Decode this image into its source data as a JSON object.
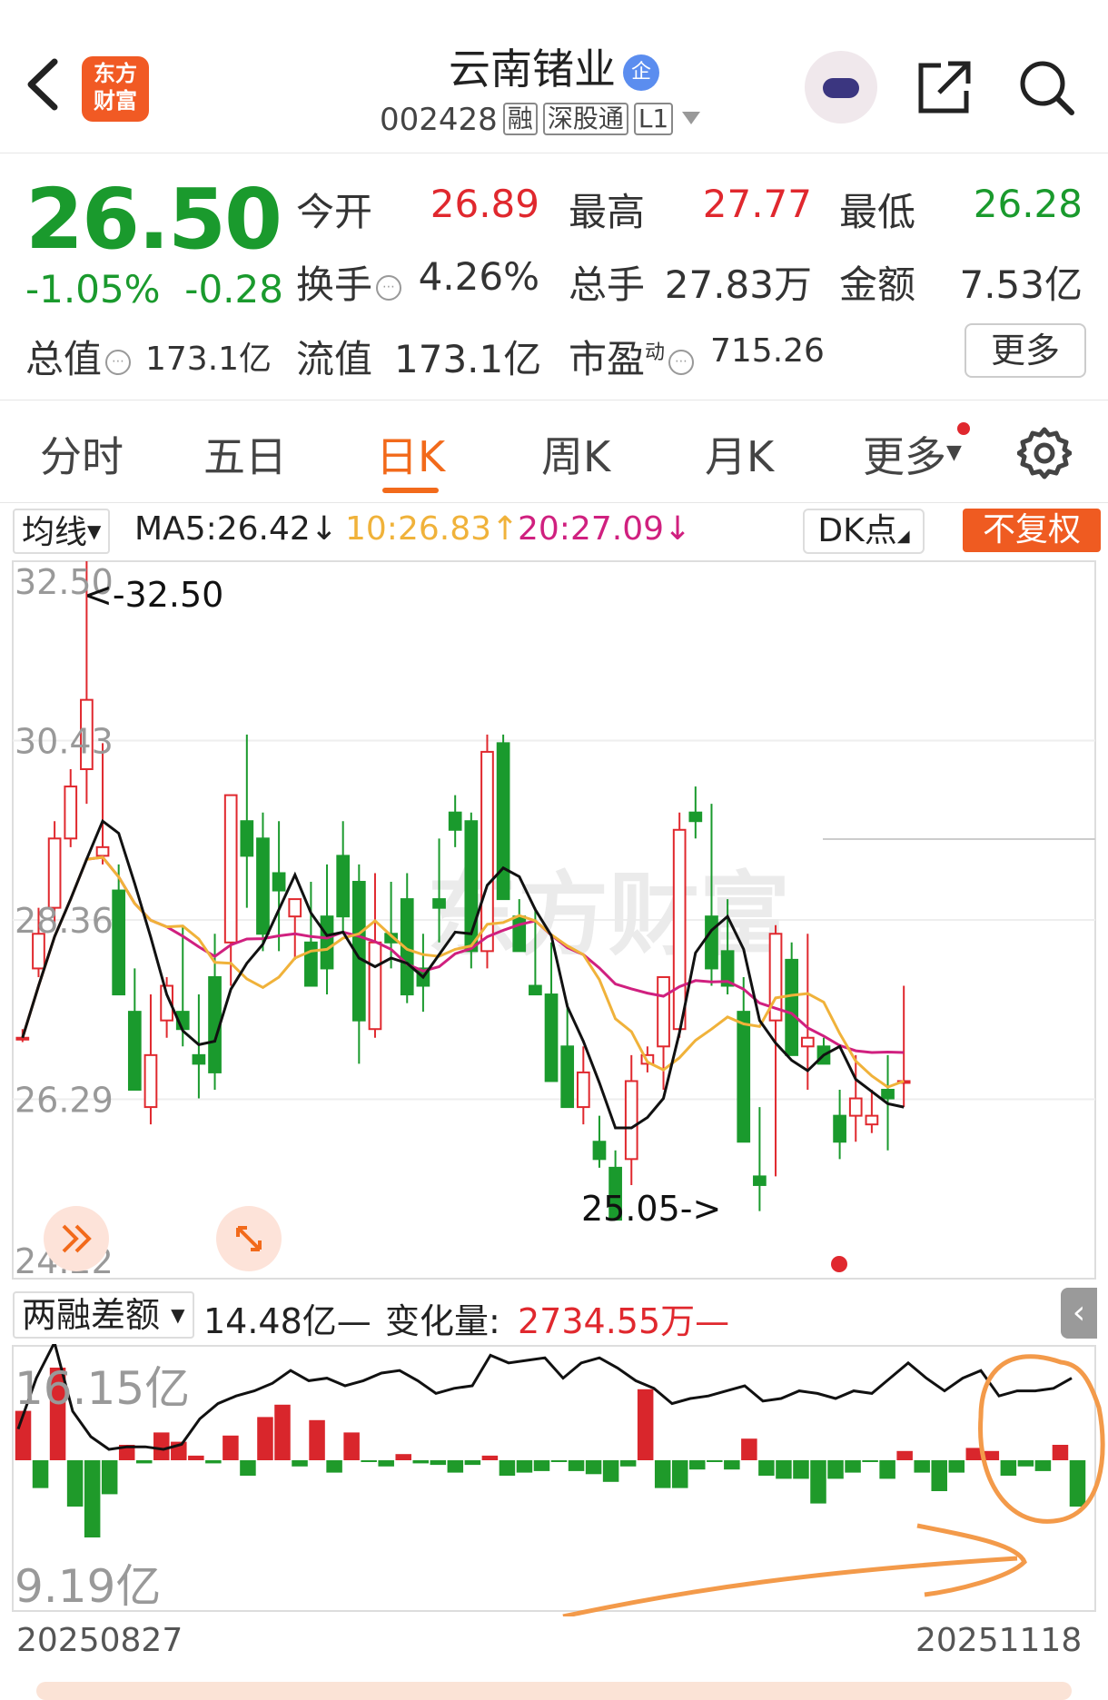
{
  "header": {
    "back_icon": "chevron-left-icon",
    "logo_text_line1": "东方",
    "logo_text_line2": "财富",
    "stock_name": "云南锗业",
    "qi_badge": "企",
    "stock_code": "002428",
    "tags": [
      "融",
      "深股通",
      "L1"
    ],
    "icons": [
      "assistant-robot-icon",
      "share-icon",
      "search-icon"
    ]
  },
  "quote": {
    "price": "26.50",
    "change_pct": "-1.05%",
    "change_amt": "-0.28",
    "open_label": "今开",
    "open": "26.89",
    "high_label": "最高",
    "high": "27.77",
    "low_label": "最低",
    "low": "26.28",
    "turnover_label": "换手",
    "turnover": "4.26%",
    "volume_label": "总手",
    "volume": "27.83万",
    "amount_label": "金额",
    "amount": "7.53亿",
    "mktcap_label": "总值",
    "mktcap": "173.1亿",
    "float_label": "流值",
    "float_cap": "173.1亿",
    "pe_label": "市盈",
    "pe_sup": "动",
    "pe": "715.26",
    "more_button": "更多",
    "colors": {
      "up": "#e0282e",
      "down": "#1a9a2d"
    }
  },
  "tabs": {
    "items": [
      "分时",
      "五日",
      "日K",
      "周K",
      "月K",
      "更多"
    ],
    "active": "日K"
  },
  "ma": {
    "selector": "均线",
    "ma5": "MA5:26.42↓",
    "ma10": "10:26.83↑",
    "ma20": "20:27.09↓",
    "dk_button": "DK点",
    "fq_button": "不复权",
    "colors": {
      "ma5": "#111111",
      "ma10": "#f0b23a",
      "ma20": "#d0207f"
    }
  },
  "chart_data": [
    {
      "type": "candlestick",
      "y_ticks": [
        "32.50",
        "30.43",
        "28.36",
        "26.29",
        "24.22"
      ],
      "ylim": [
        24.22,
        32.5
      ],
      "high_marker": "<-32.50",
      "low_marker": "25.05->",
      "watermark": "东方财富",
      "candles": [
        [
          27.0,
          27.1,
          26.95,
          27.0
        ],
        [
          27.8,
          28.5,
          27.7,
          28.2
        ],
        [
          28.5,
          29.5,
          28.3,
          29.3
        ],
        [
          29.3,
          30.1,
          29.2,
          29.9
        ],
        [
          30.1,
          32.5,
          29.7,
          30.9
        ],
        [
          29.1,
          30.4,
          29.0,
          29.2
        ],
        [
          28.7,
          29.0,
          27.8,
          27.5
        ],
        [
          27.3,
          27.8,
          26.8,
          26.4
        ],
        [
          26.2,
          27.5,
          26.0,
          26.8
        ],
        [
          27.2,
          27.7,
          27.0,
          27.6
        ],
        [
          27.3,
          28.3,
          26.9,
          27.1
        ],
        [
          26.8,
          27.5,
          26.3,
          26.7
        ],
        [
          27.7,
          28.2,
          26.4,
          26.6
        ],
        [
          28.1,
          29.3,
          27.6,
          29.8
        ],
        [
          29.5,
          30.5,
          28.5,
          29.1
        ],
        [
          29.3,
          29.6,
          28.0,
          28.2
        ],
        [
          28.9,
          29.5,
          28.0,
          28.7
        ],
        [
          28.4,
          28.6,
          27.9,
          28.6
        ],
        [
          28.1,
          28.8,
          27.6,
          27.6
        ],
        [
          28.4,
          29.0,
          27.5,
          27.8
        ],
        [
          29.1,
          29.5,
          28.2,
          28.4
        ],
        [
          28.8,
          29.0,
          26.7,
          27.2
        ],
        [
          27.1,
          28.9,
          27.0,
          28.1
        ],
        [
          28.2,
          28.8,
          27.8,
          28.1
        ],
        [
          28.6,
          28.9,
          27.4,
          27.5
        ],
        [
          27.8,
          28.2,
          27.3,
          27.6
        ],
        [
          28.6,
          29.3,
          28.1,
          28.5
        ],
        [
          29.6,
          29.8,
          29.2,
          29.4
        ],
        [
          29.5,
          29.6,
          27.8,
          28.0
        ],
        [
          28.0,
          30.5,
          27.8,
          30.3
        ],
        [
          30.4,
          30.5,
          28.6,
          28.6
        ],
        [
          28.4,
          28.6,
          28.0,
          28.0
        ],
        [
          27.6,
          28.5,
          27.5,
          27.5
        ],
        [
          27.5,
          28.1,
          26.7,
          26.5
        ],
        [
          26.9,
          27.4,
          26.2,
          26.2
        ],
        [
          26.2,
          26.9,
          26.0,
          26.6
        ],
        [
          25.8,
          26.1,
          25.5,
          25.6
        ],
        [
          25.5,
          25.7,
          25.05,
          24.9
        ],
        [
          25.6,
          26.8,
          25.3,
          26.5
        ],
        [
          26.7,
          26.9,
          26.6,
          26.8
        ],
        [
          26.9,
          27.7,
          26.4,
          27.7
        ],
        [
          27.1,
          29.6,
          27.0,
          29.4
        ],
        [
          29.6,
          29.9,
          29.3,
          29.5
        ],
        [
          28.4,
          29.7,
          27.6,
          27.8
        ],
        [
          28.0,
          28.6,
          27.5,
          27.6
        ],
        [
          27.3,
          27.7,
          26.0,
          25.8
        ],
        [
          25.4,
          26.2,
          25.0,
          25.3
        ],
        [
          27.2,
          28.3,
          25.4,
          28.2
        ],
        [
          27.9,
          28.1,
          26.9,
          26.8
        ],
        [
          26.9,
          28.2,
          26.4,
          27.0
        ],
        [
          26.9,
          27.0,
          26.7,
          26.7
        ],
        [
          26.1,
          26.4,
          25.6,
          25.8
        ],
        [
          26.1,
          26.8,
          25.8,
          26.3
        ],
        [
          26.0,
          26.4,
          25.9,
          26.1
        ],
        [
          26.4,
          26.8,
          25.7,
          26.3
        ],
        [
          26.5,
          27.6,
          26.2,
          26.5
        ]
      ]
    },
    {
      "type": "bar+line",
      "label": "两融差额",
      "latest": "14.48亿—",
      "change_label": "变化量:",
      "change": "2734.55万—",
      "y_ticks": [
        "16.15亿",
        "9.19亿"
      ],
      "x_start": "20250827",
      "x_end": "20251118",
      "change_bars": [
        32,
        -18,
        60,
        -30,
        -50,
        -22,
        10,
        -2,
        18,
        12,
        3,
        -2,
        16,
        -10,
        28,
        36,
        -4,
        26,
        -8,
        18,
        -1,
        -4,
        4,
        -2,
        -3,
        -8,
        -3,
        3,
        -10,
        -8,
        -7,
        -1,
        -7,
        -9,
        -14,
        -4,
        46,
        -18,
        -18,
        -6,
        -1,
        -6,
        14,
        -10,
        -12,
        -12,
        -28,
        -12,
        -8,
        -1,
        -12,
        6,
        -8,
        -20,
        -8,
        8,
        6,
        -10,
        -4,
        -7,
        10,
        -30
      ],
      "balance_line": [
        43,
        63,
        77,
        50,
        40,
        35,
        36,
        36,
        35,
        37,
        47,
        53,
        56,
        58,
        61,
        66,
        62,
        63,
        60,
        62,
        65,
        66,
        62,
        57,
        59,
        60,
        72,
        69,
        70,
        71,
        63,
        69,
        71,
        67,
        62,
        59,
        53,
        55,
        56,
        58,
        60,
        54,
        55,
        58,
        57,
        55,
        58,
        57,
        63,
        69,
        63,
        58,
        63,
        66,
        56,
        58,
        58,
        59,
        63
      ]
    }
  ],
  "annotations": {
    "circle_color": "#f39a4a"
  }
}
